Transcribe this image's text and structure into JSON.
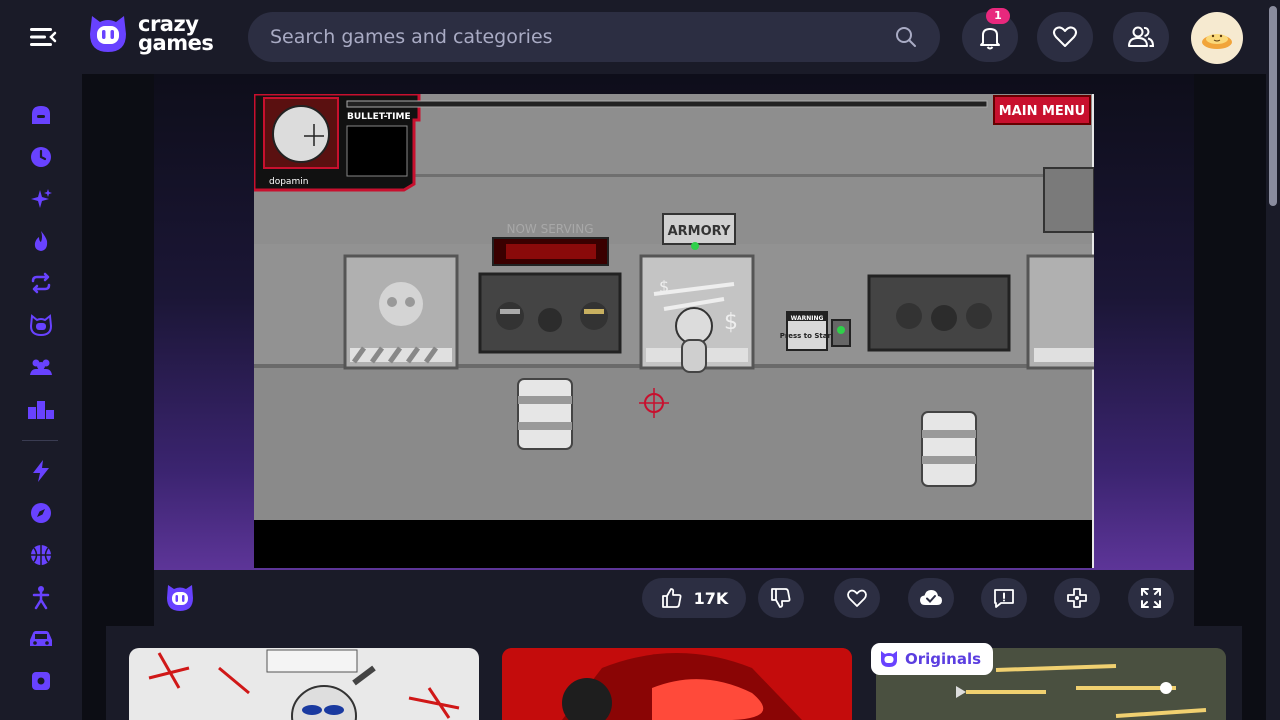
{
  "header": {
    "logo_line1": "crazy",
    "logo_line2": "games",
    "search_placeholder": "Search games and categories",
    "notification_count": "1"
  },
  "sidebar": {
    "items": [
      "home-icon",
      "clock-icon",
      "sparkle-icon",
      "fire-icon",
      "refresh-icon",
      "twitch-icon",
      "users-icon",
      "leaderboard-icon",
      "bolt-icon",
      "compass-icon",
      "basketball-icon",
      "stickman-icon",
      "car-icon",
      "dice-icon"
    ]
  },
  "game": {
    "hud_label": "BULLET-TIME",
    "player_name": "dopamin",
    "main_menu_label": "MAIN MENU",
    "now_serving_label": "NOW SERVING",
    "armory_label": "ARMORY",
    "warning_label": "WARNING",
    "press_start_label": "Press to Start"
  },
  "toolbar": {
    "like_count": "17K"
  },
  "recommended": {
    "originals_label": "Originals"
  },
  "colors": {
    "brand_purple": "#6842ff",
    "header_bg": "#1a1b28",
    "accent_pink": "#e8287d",
    "hud_red": "#c8102e"
  }
}
